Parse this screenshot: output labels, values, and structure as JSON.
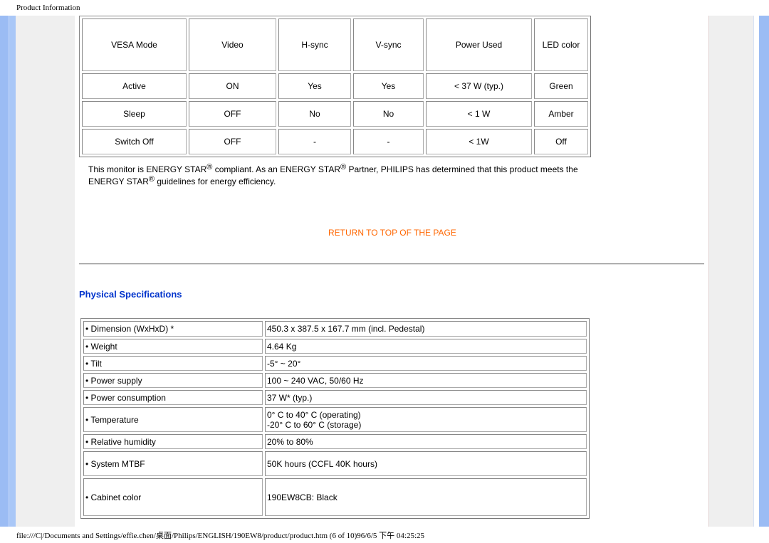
{
  "header": {
    "title": "Product Information"
  },
  "power_table": {
    "headers": [
      "VESA Mode",
      "Video",
      "H-sync",
      "V-sync",
      "Power Used",
      "LED color"
    ],
    "rows": [
      [
        "Active",
        "ON",
        "Yes",
        "Yes",
        "< 37 W (typ.)",
        "Green"
      ],
      [
        "Sleep",
        "OFF",
        "No",
        "No",
        "< 1 W",
        "Amber"
      ],
      [
        "Switch Off",
        "OFF",
        "-",
        "-",
        "< 1W",
        "Off"
      ]
    ]
  },
  "note": {
    "p1": "This monitor is ENERGY STAR",
    "reg": "®",
    "p2": " compliant. As an ENERGY STAR",
    "p3": " Partner, PHILIPS has determined that this product meets the ENERGY STAR",
    "p4": " guidelines for energy efficiency."
  },
  "return_link": "RETURN TO TOP OF THE PAGE",
  "physical": {
    "title": "Physical Specifications",
    "rows": [
      [
        "• Dimension (WxHxD) *",
        "450.3 x 387.5 x 167.7 mm (incl. Pedestal)"
      ],
      [
        "• Weight",
        "4.64 Kg"
      ],
      [
        "• Tilt",
        "-5° ~ 20°"
      ],
      [
        "• Power supply",
        "100 ~ 240 VAC, 50/60 Hz"
      ],
      [
        "• Power consumption",
        "37 W* (typ.)"
      ],
      [
        "• Temperature",
        "0° C to 40° C (operating)",
        "-20° C to 60° C (storage)"
      ],
      [
        "• Relative humidity",
        "20% to 80%"
      ],
      [
        "• System MTBF",
        "50K hours (CCFL 40K hours)"
      ],
      [
        "• Cabinet color",
        "190EW8CB: Black"
      ]
    ]
  },
  "footer": "file:///C|/Documents and Settings/effie.chen/桌面/Philips/ENGLISH/190EW8/product/product.htm (6 of 10)96/6/5 下午 04:25:25"
}
